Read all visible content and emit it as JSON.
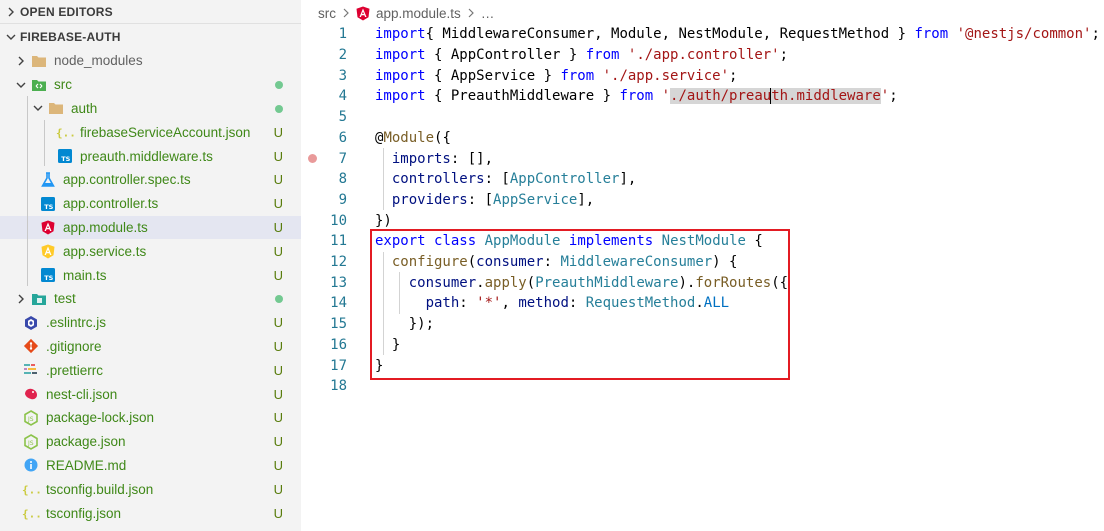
{
  "sidebar": {
    "open_editors_label": "OPEN EDITORS",
    "project_label": "FIREBASE-AUTH",
    "tree": [
      {
        "name": "node_modules",
        "icon": "folder-icon",
        "depth": 0,
        "twist": "right",
        "badge": ""
      },
      {
        "name": "src",
        "icon": "folder-src-icon",
        "depth": 0,
        "twist": "down",
        "badge": "dot"
      },
      {
        "name": "auth",
        "icon": "folder-icon",
        "depth": 1,
        "twist": "down",
        "badge": "dot"
      },
      {
        "name": "firebaseServiceAccount.json",
        "icon": "json-icon",
        "depth": 2,
        "twist": "",
        "badge": "U"
      },
      {
        "name": "preauth.middleware.ts",
        "icon": "ts-icon",
        "depth": 2,
        "twist": "",
        "badge": "U"
      },
      {
        "name": "app.controller.spec.ts",
        "icon": "test-flask-icon",
        "depth": 1,
        "twist": "",
        "badge": "U"
      },
      {
        "name": "app.controller.ts",
        "icon": "ts-icon",
        "depth": 1,
        "twist": "",
        "badge": "U"
      },
      {
        "name": "app.module.ts",
        "icon": "angular-icon",
        "depth": 1,
        "twist": "",
        "badge": "U",
        "selected": true
      },
      {
        "name": "app.service.ts",
        "icon": "angular-service-icon",
        "depth": 1,
        "twist": "",
        "badge": "U"
      },
      {
        "name": "main.ts",
        "icon": "ts-icon",
        "depth": 1,
        "twist": "",
        "badge": "U"
      },
      {
        "name": "test",
        "icon": "folder-test-icon",
        "depth": 0,
        "twist": "right",
        "badge": "dot"
      },
      {
        "name": ".eslintrc.js",
        "icon": "eslint-icon",
        "depth": 0,
        "twist": "",
        "badge": "U"
      },
      {
        "name": ".gitignore",
        "icon": "git-icon",
        "depth": 0,
        "twist": "",
        "badge": "U"
      },
      {
        "name": ".prettierrc",
        "icon": "prettier-icon",
        "depth": 0,
        "twist": "",
        "badge": "U"
      },
      {
        "name": "nest-cli.json",
        "icon": "nest-icon",
        "depth": 0,
        "twist": "",
        "badge": "U"
      },
      {
        "name": "package-lock.json",
        "icon": "nodejs-icon",
        "depth": 0,
        "twist": "",
        "badge": "U"
      },
      {
        "name": "package.json",
        "icon": "nodejs-icon",
        "depth": 0,
        "twist": "",
        "badge": "U"
      },
      {
        "name": "README.md",
        "icon": "info-icon",
        "depth": 0,
        "twist": "",
        "badge": "U"
      },
      {
        "name": "tsconfig.build.json",
        "icon": "json-icon",
        "depth": 0,
        "twist": "",
        "badge": "U"
      },
      {
        "name": "tsconfig.json",
        "icon": "json-icon",
        "depth": 0,
        "twist": "",
        "badge": "U"
      }
    ]
  },
  "editor": {
    "breadcrumb": {
      "folder": "src",
      "file": "app.module.ts",
      "more": "…"
    },
    "lines": [
      {
        "n": "1",
        "tokens": [
          [
            "kw",
            "import"
          ],
          [
            "",
            "{ MiddlewareConsumer, Module, NestModule, RequestMethod } "
          ],
          [
            "kw",
            "from"
          ],
          [
            "",
            " "
          ],
          [
            "str",
            "'@nestjs/common'"
          ],
          [
            "",
            ";"
          ]
        ]
      },
      {
        "n": "2",
        "tokens": [
          [
            "kw",
            "import"
          ],
          [
            "",
            " { AppController } "
          ],
          [
            "kw",
            "from"
          ],
          [
            "",
            " "
          ],
          [
            "str",
            "'./app.controller'"
          ],
          [
            "",
            ";"
          ]
        ]
      },
      {
        "n": "3",
        "tokens": [
          [
            "kw",
            "import"
          ],
          [
            "",
            " { AppService } "
          ],
          [
            "kw",
            "from"
          ],
          [
            "",
            " "
          ],
          [
            "str",
            "'./app.service'"
          ],
          [
            "",
            ";"
          ]
        ]
      },
      {
        "n": "4",
        "tokens": [
          [
            "kw",
            "import"
          ],
          [
            "",
            " { PreauthMiddleware } "
          ],
          [
            "kw",
            "from"
          ],
          [
            "",
            " "
          ],
          [
            "str",
            "'"
          ],
          [
            "str hl-word",
            "./auth/preau"
          ],
          [
            "cursor",
            ""
          ],
          [
            "str hl-word",
            "th.middleware"
          ],
          [
            "str",
            "'"
          ],
          [
            "",
            ";"
          ]
        ]
      },
      {
        "n": "5",
        "tokens": []
      },
      {
        "n": "6",
        "tokens": [
          [
            "",
            "@"
          ],
          [
            "tok-fn",
            "Module"
          ],
          [
            "",
            "({"
          ]
        ]
      },
      {
        "n": "7",
        "tokens": [
          [
            "",
            "  "
          ],
          [
            "prop",
            "imports"
          ],
          [
            "",
            ": [],"
          ]
        ]
      },
      {
        "n": "8",
        "tokens": [
          [
            "",
            "  "
          ],
          [
            "prop",
            "controllers"
          ],
          [
            "",
            ": ["
          ],
          [
            "typ",
            "AppController"
          ],
          [
            "",
            "],"
          ]
        ]
      },
      {
        "n": "9",
        "tokens": [
          [
            "",
            "  "
          ],
          [
            "prop",
            "providers"
          ],
          [
            "",
            ": ["
          ],
          [
            "typ",
            "AppService"
          ],
          [
            "",
            "],"
          ]
        ]
      },
      {
        "n": "10",
        "tokens": [
          [
            "",
            "})"
          ]
        ]
      },
      {
        "n": "11",
        "tokens": [
          [
            "kw",
            "export"
          ],
          [
            "",
            " "
          ],
          [
            "kw",
            "class"
          ],
          [
            "",
            " "
          ],
          [
            "typ",
            "AppModule"
          ],
          [
            "",
            " "
          ],
          [
            "kw",
            "implements"
          ],
          [
            "",
            " "
          ],
          [
            "typ",
            "NestModule"
          ],
          [
            "",
            " {"
          ]
        ]
      },
      {
        "n": "12",
        "tokens": [
          [
            "",
            "  "
          ],
          [
            "tok-fn",
            "configure"
          ],
          [
            "",
            "("
          ],
          [
            "prop",
            "consumer"
          ],
          [
            "",
            ": "
          ],
          [
            "typ",
            "MiddlewareConsumer"
          ],
          [
            "",
            ") {"
          ]
        ]
      },
      {
        "n": "13",
        "tokens": [
          [
            "",
            "    "
          ],
          [
            "prop",
            "consumer"
          ],
          [
            "",
            "."
          ],
          [
            "tok-fn",
            "apply"
          ],
          [
            "",
            "("
          ],
          [
            "typ",
            "PreauthMiddleware"
          ],
          [
            "",
            ")."
          ],
          [
            "tok-fn",
            "forRoutes"
          ],
          [
            "",
            "({"
          ]
        ]
      },
      {
        "n": "14",
        "tokens": [
          [
            "",
            "      "
          ],
          [
            "prop",
            "path"
          ],
          [
            "",
            ": "
          ],
          [
            "str",
            "'*'"
          ],
          [
            "",
            ", "
          ],
          [
            "prop",
            "method"
          ],
          [
            "",
            ": "
          ],
          [
            "typ",
            "RequestMethod"
          ],
          [
            "",
            "."
          ],
          [
            "enm",
            "ALL"
          ]
        ]
      },
      {
        "n": "15",
        "tokens": [
          [
            "",
            "    });"
          ]
        ]
      },
      {
        "n": "16",
        "tokens": [
          [
            "",
            "  }"
          ]
        ]
      },
      {
        "n": "17",
        "tokens": [
          [
            "",
            "}"
          ]
        ]
      },
      {
        "n": "18",
        "tokens": []
      }
    ]
  },
  "colors": {
    "keyword": "#0000ff",
    "string": "#a31515",
    "highlight_box": "#e31b23",
    "git_untracked": "#587c0c",
    "sidebar_bg": "#f3f3f3",
    "selected_row": "#e4e6f1"
  }
}
